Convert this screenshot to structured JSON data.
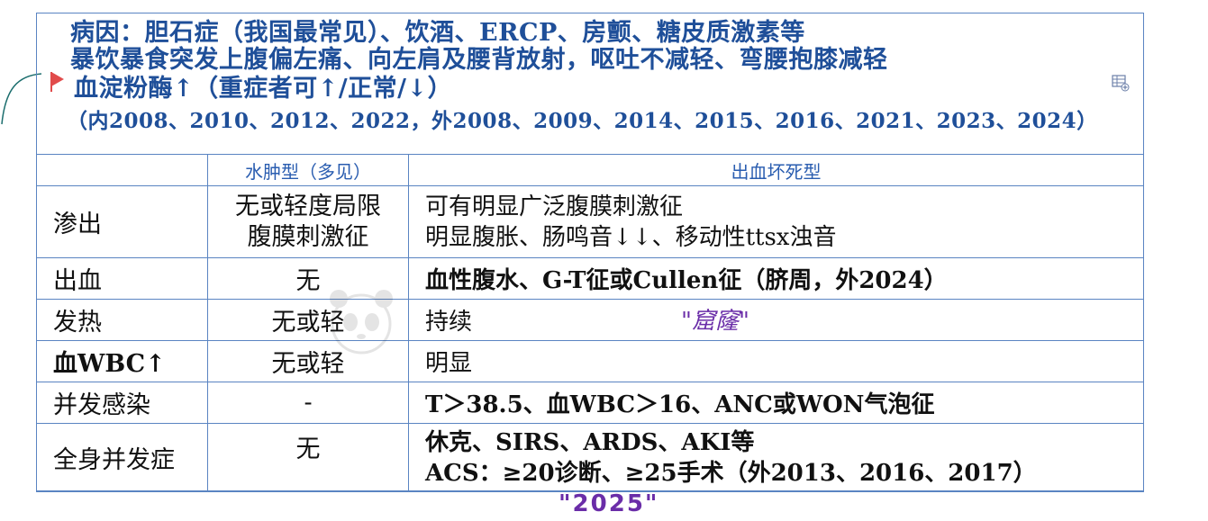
{
  "header": {
    "line1": "病因：胆石症（我国最常见）、饮酒、ERCP、房颤、糖皮质激素等",
    "line2": "暴饮暴食突发上腹偏左痛、向左肩及腰背放射，呕吐不减轻、弯腰抱膝减轻",
    "line3": "血淀粉酶↑（重症者可↑/正常/↓）",
    "line4": "（内2008、2010、2012、2022，外2008、2009、2014、2015、2016、2021、2023、2024）"
  },
  "table": {
    "col_headers": [
      "",
      "水肿型（多见）",
      "出血坏死型"
    ],
    "rows": [
      {
        "label": "渗出",
        "edema": [
          "无或轻度局限",
          "腹膜刺激征"
        ],
        "necrotic": [
          "可有明显广泛腹膜刺激征",
          "明显腹胀、肠鸣音↓↓、移动性ttsx浊音"
        ]
      },
      {
        "label": "出血",
        "edema": [
          "无"
        ],
        "necrotic": [
          "血性腹水、G-T征或Cullen征（脐周，外2024）"
        ]
      },
      {
        "label": "发热",
        "edema": [
          "无或轻"
        ],
        "necrotic": [
          "持续"
        ]
      },
      {
        "label": "血WBC↑",
        "edema": [
          "无或轻"
        ],
        "necrotic": [
          "明显"
        ]
      },
      {
        "label": "并发感染",
        "edema": [
          "-"
        ],
        "necrotic": [
          "T＞38.5、血WBC＞16、ANC或WON气泡征"
        ]
      },
      {
        "label": "全身并发症",
        "edema": [
          "无"
        ],
        "necrotic": [
          "休克、SIRS、ARDS、AKI等",
          "ACS：≥20诊断、≥25手术（外2013、2016、2017）"
        ]
      }
    ]
  },
  "annotations": {
    "handwritten_1": "\"窟窿\"",
    "handwritten_2": "\"2025\""
  },
  "colors": {
    "header_text": "#1f4f99",
    "border": "#5a84c2",
    "handwriting": "#6a2da8",
    "flag": "#e14b4b"
  },
  "icons": [
    "flag-icon",
    "table-insert-icon",
    "panda-watermark-icon"
  ]
}
